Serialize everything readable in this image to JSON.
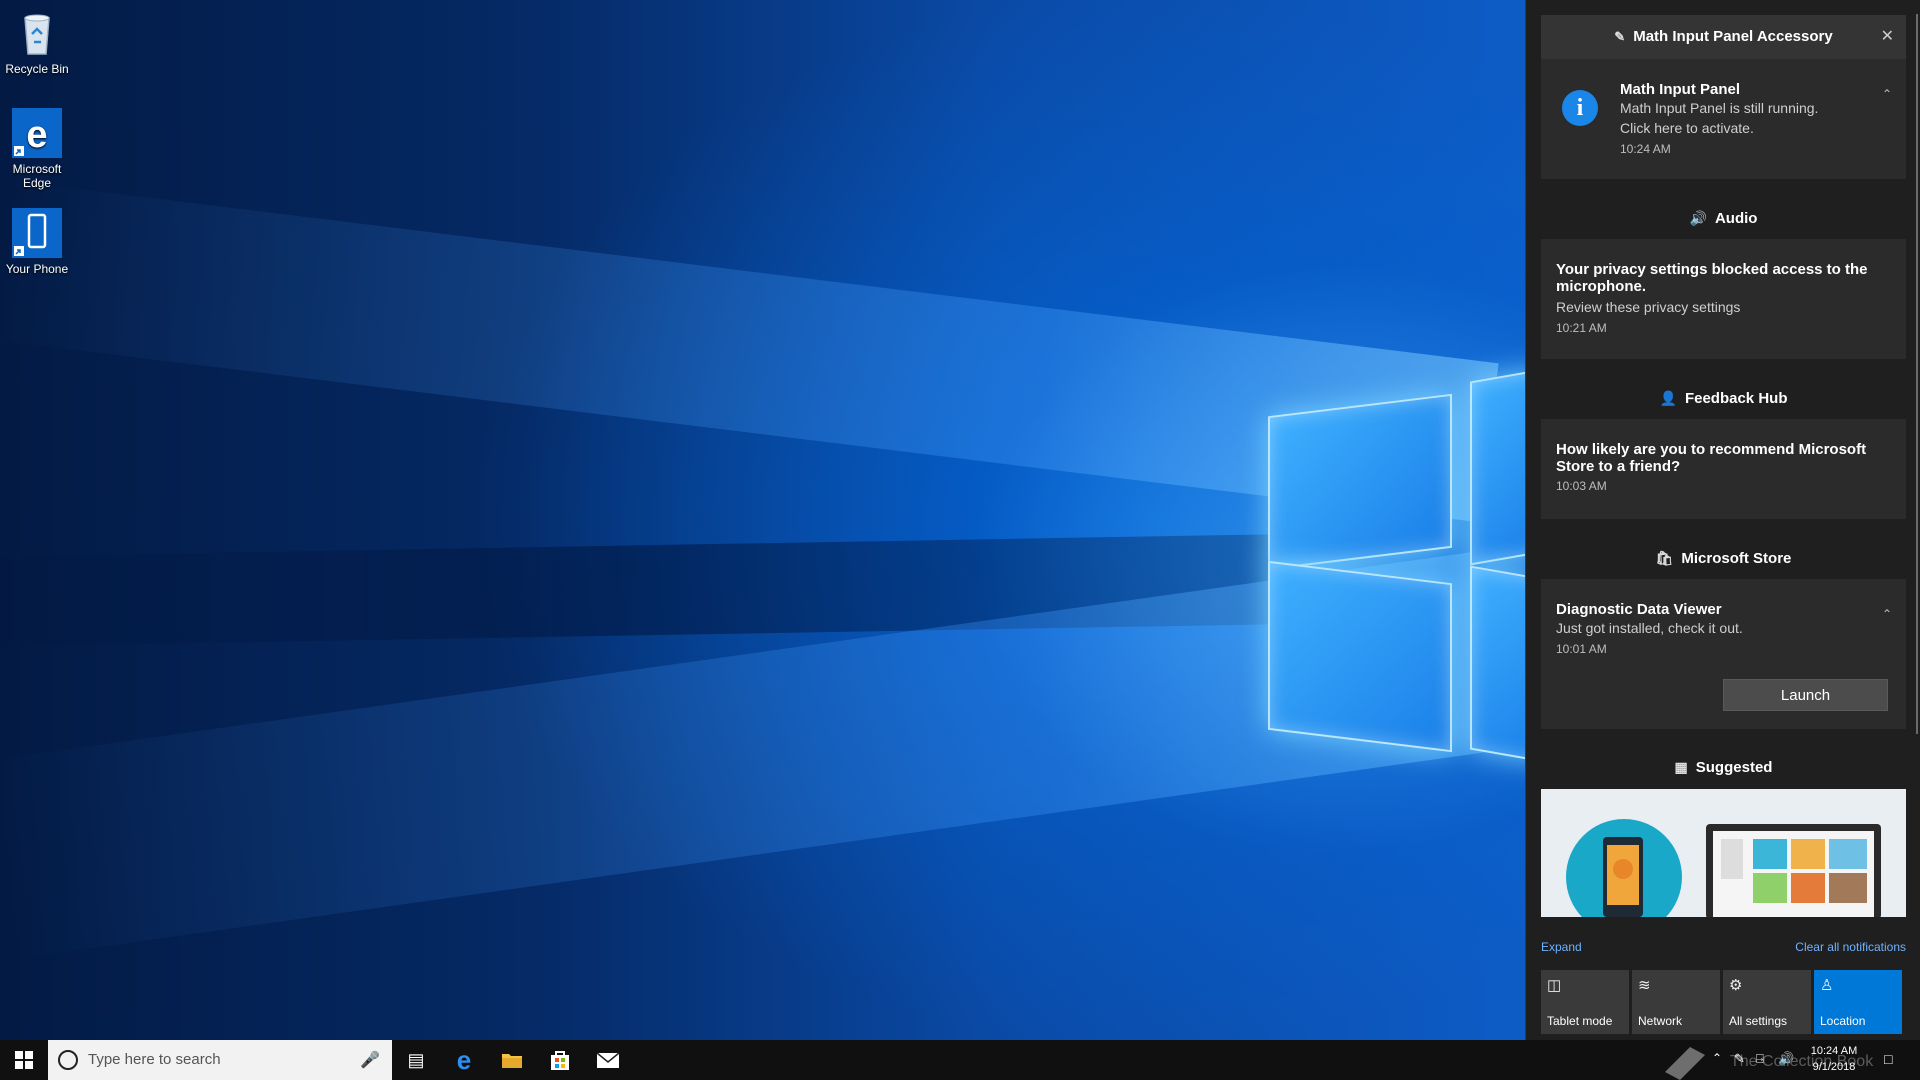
{
  "desktop": {
    "icons": [
      {
        "label": "Recycle Bin",
        "icon": "recycle-bin-icon"
      },
      {
        "label": "Microsoft Edge",
        "icon": "edge-icon"
      },
      {
        "label": "Your Phone",
        "icon": "phone-icon"
      }
    ]
  },
  "action_center": {
    "header": {
      "title": "Math Input Panel Accessory",
      "icon": "math-input-icon"
    },
    "math_card": {
      "title": "Math Input Panel",
      "body1": "Math Input Panel is still running.",
      "body2": "Click here to activate.",
      "time": "10:24 AM"
    },
    "audio": {
      "group_title": "Audio",
      "title1": "Your privacy settings blocked access to the",
      "title2": "microphone.",
      "body": "Review these privacy settings",
      "time": "10:21 AM"
    },
    "feedback": {
      "group_title": "Feedback Hub",
      "title1": "How likely are you to recommend Microsoft",
      "title2": "Store to a friend?",
      "time": "10:03 AM"
    },
    "store": {
      "group_title": "Microsoft Store",
      "title": "Diagnostic Data Viewer",
      "body": "Just got installed, check it out.",
      "time": "10:01 AM",
      "button": "Launch"
    },
    "suggested": {
      "group_title": "Suggested"
    },
    "expand": "Expand",
    "clear_all": "Clear all notifications",
    "quick_actions": [
      {
        "label": "Tablet mode",
        "icon": "tablet-mode-icon",
        "active": false
      },
      {
        "label": "Network",
        "icon": "network-icon",
        "active": false
      },
      {
        "label": "All settings",
        "icon": "gear-icon",
        "active": false
      },
      {
        "label": "Location",
        "icon": "location-icon",
        "active": true
      }
    ]
  },
  "taskbar": {
    "search_placeholder": "Type here to search",
    "clock_time": "10:24 AM",
    "clock_date": "9/1/2018"
  },
  "watermark": "The Collection Book",
  "colors": {
    "accent": "#0078d7",
    "action_center_bg": "#1f1f1f",
    "card_bg": "#2b2b2b"
  }
}
